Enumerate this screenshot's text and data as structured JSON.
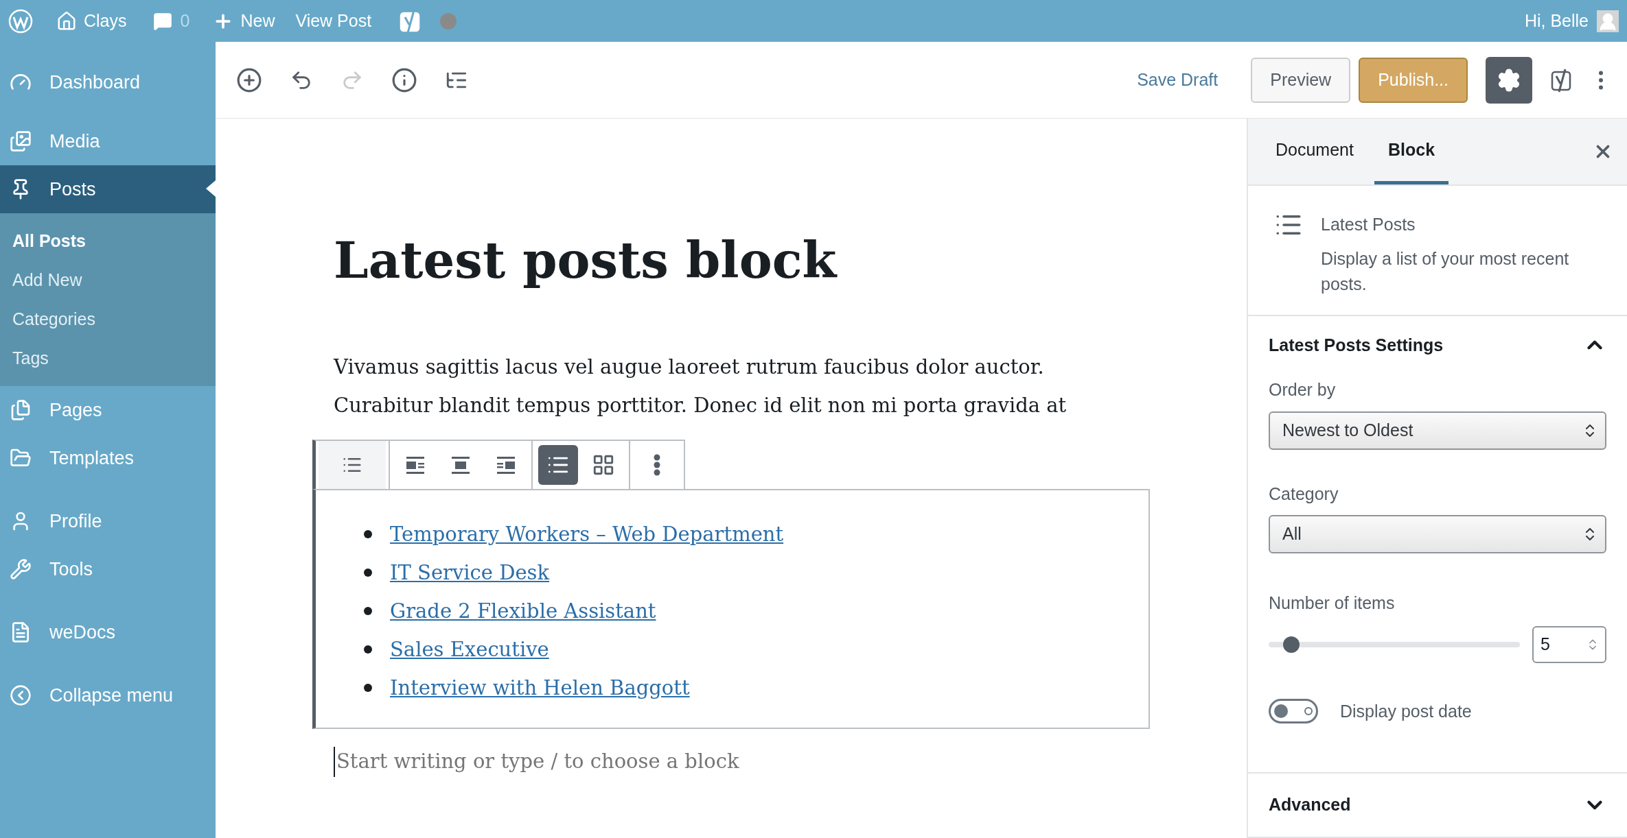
{
  "admin_bar": {
    "site": "Clays",
    "comments": "0",
    "new": "New",
    "view_post": "View Post",
    "greeting": "Hi, Belle"
  },
  "sidebar": {
    "items": [
      {
        "label": "Dashboard",
        "selected": false
      },
      {
        "label": "Media",
        "selected": false
      },
      {
        "label": "Posts",
        "selected": true,
        "children": [
          {
            "label": "All Posts",
            "selected": true
          },
          {
            "label": "Add New",
            "selected": false
          },
          {
            "label": "Categories",
            "selected": false
          },
          {
            "label": "Tags",
            "selected": false
          }
        ]
      },
      {
        "label": "Pages",
        "selected": false
      },
      {
        "label": "Templates",
        "selected": false
      },
      {
        "label": "Profile",
        "selected": false
      },
      {
        "label": "Tools",
        "selected": false
      },
      {
        "label": "weDocs",
        "selected": false
      },
      {
        "label": "Collapse menu",
        "selected": false
      }
    ]
  },
  "header": {
    "redo_disabled": true,
    "save_draft": "Save Draft",
    "preview": "Preview",
    "publish": "Publish...",
    "settings_selected": true
  },
  "editor": {
    "title": "Latest posts block",
    "paragraph": "Vivamus sagittis lacus vel augue laoreet rutrum faucibus dolor auctor. Curabitur blandit tempus porttitor. Donec id elit non mi porta gravida at",
    "block_toolbar": [
      {
        "kind": "block-type",
        "selected": false
      },
      {
        "kind": "align-left",
        "selected": false
      },
      {
        "kind": "align-center",
        "selected": false
      },
      {
        "kind": "align-right",
        "selected": false
      },
      {
        "kind": "list-view",
        "selected": true
      },
      {
        "kind": "grid-view",
        "selected": false
      },
      {
        "kind": "more",
        "selected": false
      }
    ],
    "latest_posts": [
      "Temporary Workers – Web Department",
      "IT Service Desk",
      "Grade 2 Flexible Assistant",
      "Sales Executive",
      "Interview with Helen Baggott"
    ],
    "placeholder": "Start writing or type / to choose a block"
  },
  "inspector": {
    "tabs": [
      {
        "label": "Document",
        "selected": false
      },
      {
        "label": "Block",
        "selected": true
      }
    ],
    "block": {
      "name": "Latest Posts",
      "description": "Display a list of your most recent posts."
    },
    "settings": {
      "title": "Latest Posts Settings",
      "expanded": true,
      "order_by": {
        "label": "Order by",
        "value": "Newest to Oldest"
      },
      "category": {
        "label": "Category",
        "value": "All"
      },
      "number_of_items": {
        "label": "Number of items",
        "level": 0.09,
        "value": "5"
      },
      "display_post_date": {
        "label": "Display post date",
        "on": false
      }
    },
    "advanced": {
      "title": "Advanced",
      "expanded": false
    }
  }
}
